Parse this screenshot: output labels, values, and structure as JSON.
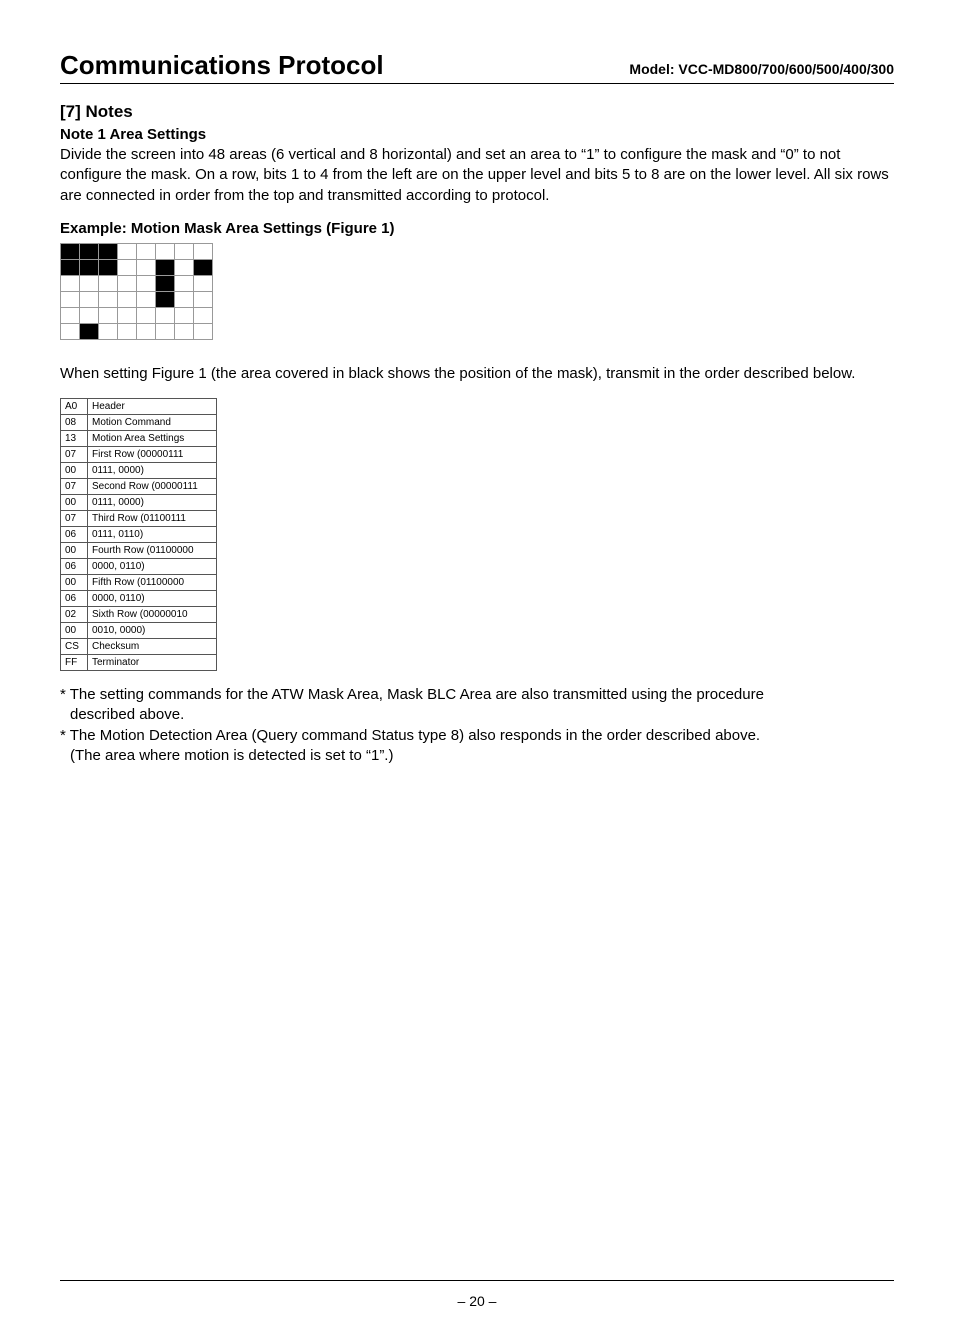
{
  "header": {
    "title": "Communications Protocol",
    "model": "Model: VCC-MD800/700/600/500/400/300"
  },
  "section": {
    "num_title": "[7]  Notes",
    "note_title": "Note 1  Area Settings",
    "para1": "Divide the screen into 48 areas (6 vertical and 8 horizontal) and set an area to “1” to configure the mask and “0” to not configure the mask. On a row, bits 1 to 4 from the left are on the upper level and bits 5 to 8 are on the lower level. All six rows are connected in order from the top and transmitted according to protocol.",
    "example_title": "Example: Motion Mask Area Settings (Figure 1)",
    "para2": "When setting Figure 1 (the area covered in black shows the position of the mask), transmit in the order described below."
  },
  "mask_grid": [
    [
      1,
      1,
      1,
      0,
      0,
      0,
      0,
      0
    ],
    [
      1,
      1,
      1,
      0,
      0,
      1,
      0,
      1
    ],
    [
      0,
      0,
      0,
      0,
      0,
      1,
      0,
      0
    ],
    [
      0,
      0,
      0,
      0,
      0,
      1,
      0,
      0
    ],
    [
      0,
      0,
      0,
      0,
      0,
      0,
      0,
      0
    ],
    [
      0,
      1,
      0,
      0,
      0,
      0,
      0,
      0
    ]
  ],
  "byte_table": [
    {
      "code": "A0",
      "desc": "Header"
    },
    {
      "code": "08",
      "desc": "Motion Command"
    },
    {
      "code": "13",
      "desc": "Motion Area Settings"
    },
    {
      "code": "07",
      "desc": "First Row (00000111"
    },
    {
      "code": "00",
      "desc": "0111, 0000)"
    },
    {
      "code": "07",
      "desc": "Second Row (00000111"
    },
    {
      "code": "00",
      "desc": "0111, 0000)"
    },
    {
      "code": "07",
      "desc": "Third Row (01100111"
    },
    {
      "code": "06",
      "desc": "0111, 0110)"
    },
    {
      "code": "00",
      "desc": "Fourth Row (01100000"
    },
    {
      "code": "06",
      "desc": "0000, 0110)"
    },
    {
      "code": "00",
      "desc": "Fifth Row (01100000"
    },
    {
      "code": "06",
      "desc": "0000, 0110)"
    },
    {
      "code": "02",
      "desc": "Sixth Row (00000010"
    },
    {
      "code": "00",
      "desc": "0010, 0000)"
    },
    {
      "code": "CS",
      "desc": "Checksum"
    },
    {
      "code": "FF",
      "desc": "Terminator"
    }
  ],
  "footnotes": {
    "n1a": "* The setting commands for the ATW Mask Area, Mask BLC Area are also transmitted using the procedure",
    "n1b": "described above.",
    "n2a": "* The Motion Detection Area (Query command Status type 8) also responds in the order described above.",
    "n2b": "(The area where motion is detected is set to “1”.)"
  },
  "footer": {
    "page": "– 20 –"
  }
}
